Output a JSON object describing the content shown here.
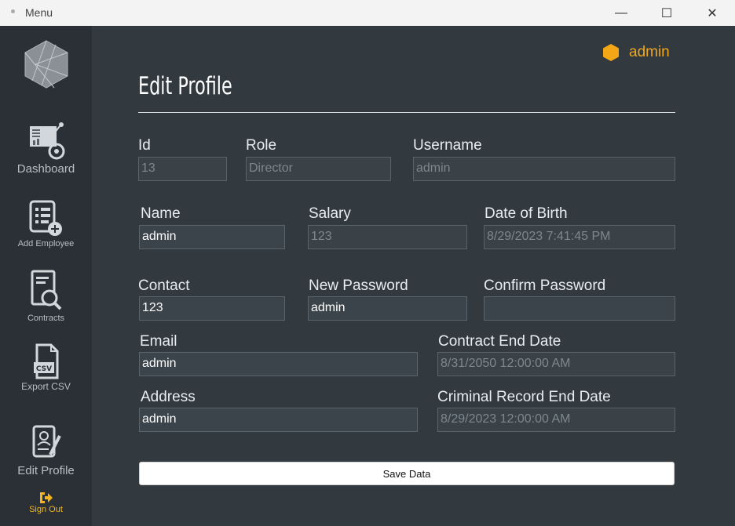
{
  "window": {
    "title": "Menu",
    "minimize_glyph": "—",
    "maximize_glyph": "☐",
    "close_glyph": "✕"
  },
  "sidebar": {
    "items": [
      {
        "label": "Dashboard",
        "icon": "dashboard-chart-icon"
      },
      {
        "label": "Add Employee",
        "icon": "add-employee-icon"
      },
      {
        "label": "Contracts",
        "icon": "contracts-search-icon"
      },
      {
        "label": "Export CSV",
        "icon": "csv-file-icon"
      },
      {
        "label": "Edit Profile",
        "icon": "edit-profile-icon"
      },
      {
        "label": "Sign Out",
        "icon": "sign-out-icon"
      }
    ]
  },
  "header": {
    "username": "admin",
    "user_icon": "hexagon-user-icon",
    "accent_color": "#f0a81c"
  },
  "page": {
    "title": "Edit Profile"
  },
  "form": {
    "id": {
      "label": "Id",
      "value": "13"
    },
    "role": {
      "label": "Role",
      "value": "Director"
    },
    "username": {
      "label": "Username",
      "value": "admin"
    },
    "name": {
      "label": "Name",
      "value": "admin"
    },
    "salary": {
      "label": "Salary",
      "value": "123"
    },
    "dob": {
      "label": "Date of Birth",
      "value": "8/29/2023 7:41:45 PM"
    },
    "contact": {
      "label": "Contact",
      "value": "123"
    },
    "new_password": {
      "label": "New Password",
      "value": "admin"
    },
    "confirm_password": {
      "label": "Confirm Password",
      "value": ""
    },
    "email": {
      "label": "Email",
      "value": "admin"
    },
    "contract_end": {
      "label": "Contract End Date",
      "value": "8/31/2050 12:00:00 AM"
    },
    "address": {
      "label": "Address",
      "value": "admin"
    },
    "criminal_end": {
      "label": "Criminal Record End Date",
      "value": "8/29/2023 12:00:00 AM"
    },
    "save_label": "Save Data"
  }
}
